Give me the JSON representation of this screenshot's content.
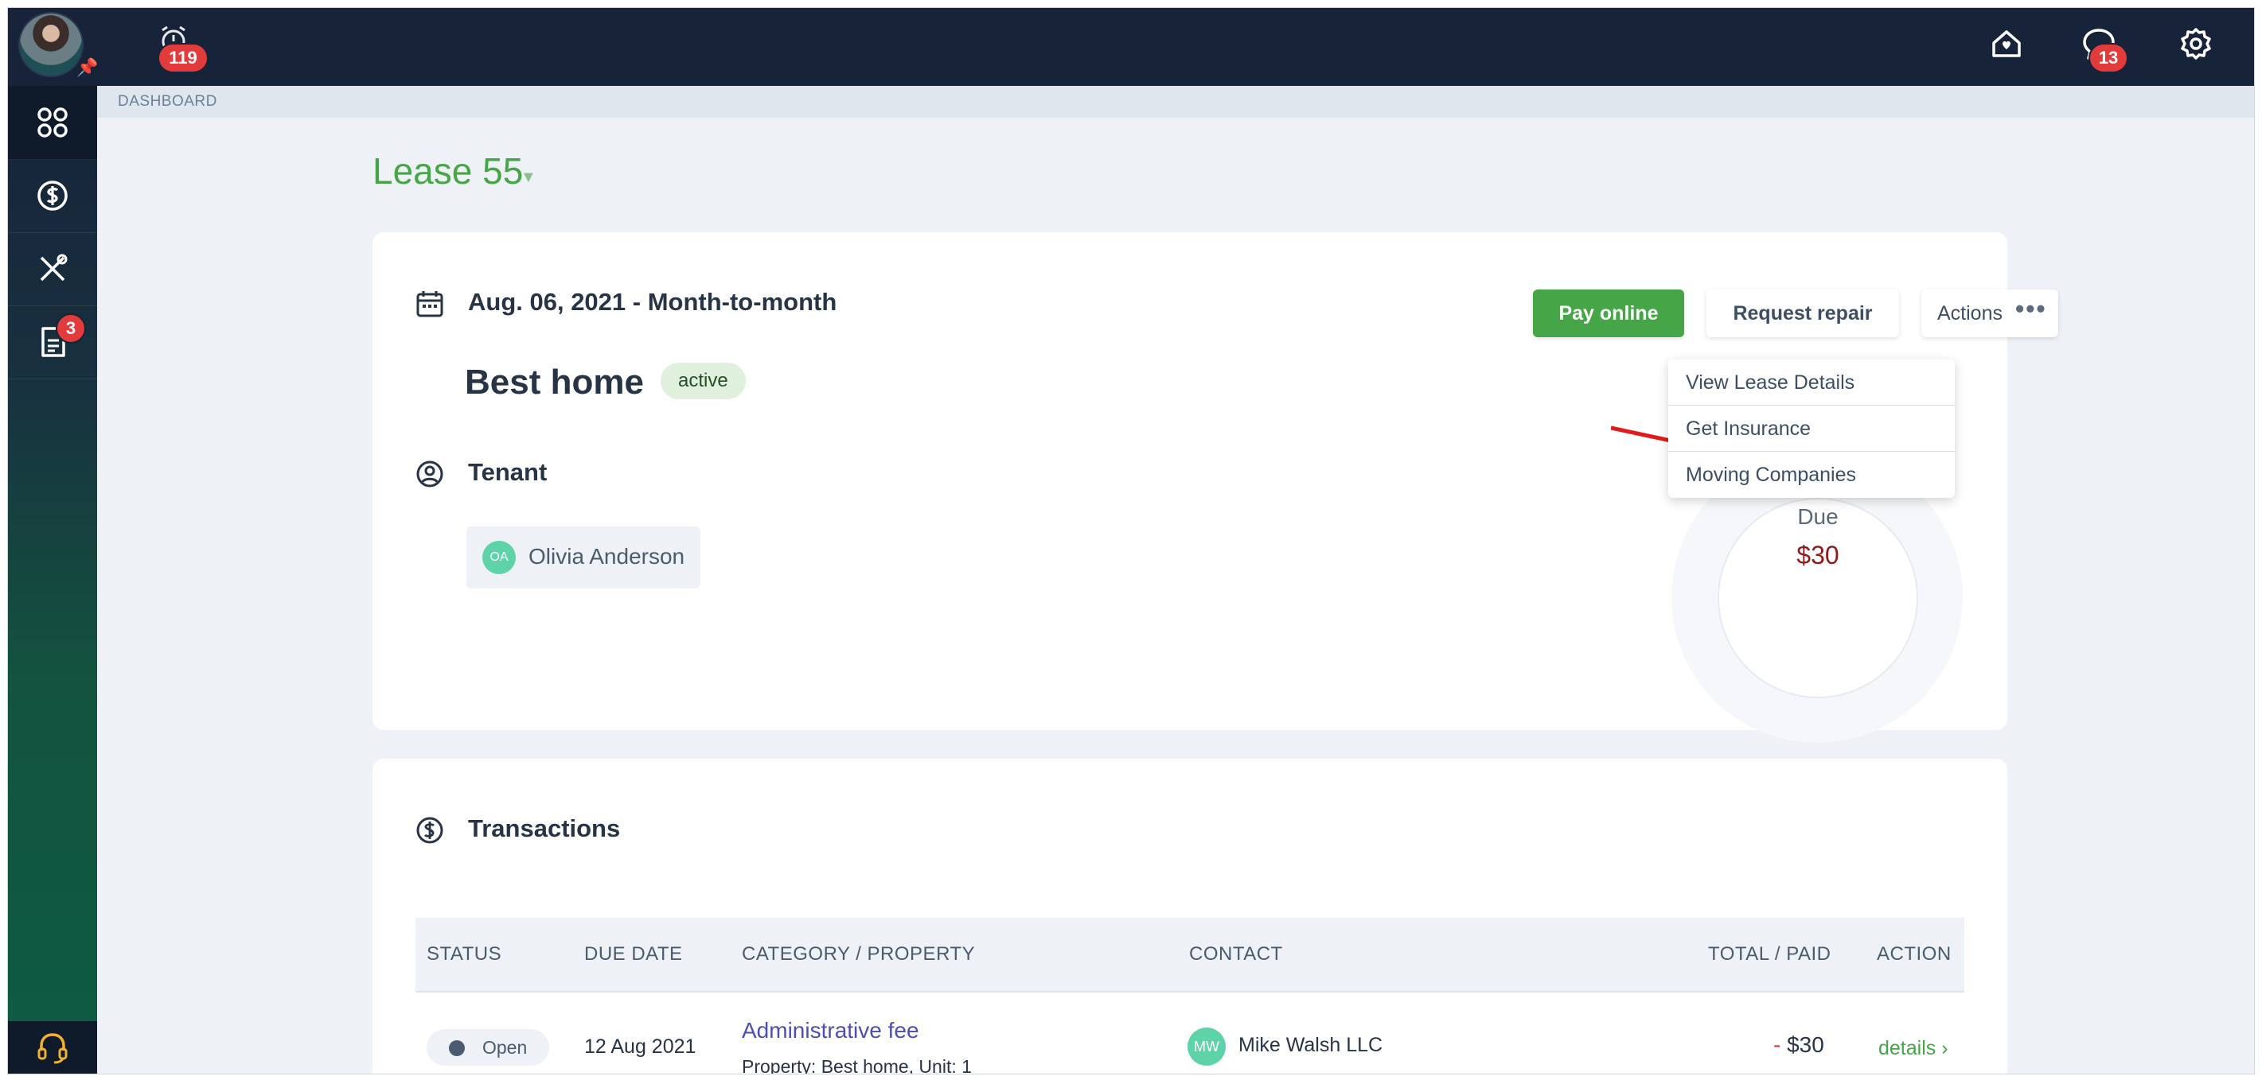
{
  "topbar": {
    "alarm_badge": "119",
    "chat_badge": "13"
  },
  "sidebar": {
    "items": [
      {
        "name": "dashboard",
        "icon": "grid-icon",
        "active": true
      },
      {
        "name": "payments",
        "icon": "dollar-icon"
      },
      {
        "name": "maintenance",
        "icon": "tools-icon"
      },
      {
        "name": "documents",
        "icon": "document-icon",
        "badge": "3"
      }
    ]
  },
  "breadcrumb": "DASHBOARD",
  "lease": {
    "title": "Lease 55",
    "date_text": "Aug. 06, 2021 - Month-to-month",
    "home_name": "Best home",
    "status_badge": "active",
    "tenant_label": "Tenant",
    "tenant": {
      "initials": "OA",
      "name": "Olivia Anderson"
    },
    "buttons": {
      "pay": "Pay online",
      "repair": "Request repair",
      "actions": "Actions"
    },
    "donut": {
      "label": "Due",
      "amount": "$30"
    }
  },
  "actions_menu": {
    "items": [
      "View Lease Details",
      "Get Insurance",
      "Moving Companies"
    ]
  },
  "transactions": {
    "title": "Transactions",
    "headers": [
      "STATUS",
      "DUE DATE",
      "CATEGORY / PROPERTY",
      "CONTACT",
      "TOTAL / PAID",
      "ACTION"
    ],
    "rows": [
      {
        "status": "Open",
        "due_date": "12 Aug 2021",
        "category": "Administrative fee",
        "property": "Property: Best home, Unit: 1",
        "contact_initials": "MW",
        "contact": "Mike Walsh LLC",
        "total_prefix": "-",
        "total": "$30",
        "action": "details"
      }
    ]
  },
  "colors": {
    "brand_green": "#46a546",
    "topbar": "#172338",
    "badge_red": "#e23b3b",
    "link_purple": "#4b4fb0"
  }
}
